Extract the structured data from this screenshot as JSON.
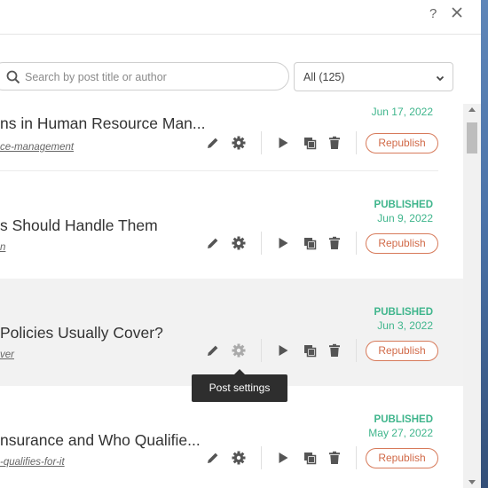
{
  "header": {
    "help_icon": "question-icon",
    "help_label": "?",
    "close_icon": "close-icon"
  },
  "search": {
    "placeholder": "Search by post title or author",
    "icon": "search-icon"
  },
  "filter": {
    "value": "All (125)"
  },
  "actions": {
    "edit_icon": "pencil-icon",
    "settings_icon": "gear-icon",
    "preview_icon": "play-icon",
    "duplicate_icon": "copy-icon",
    "delete_icon": "trash-icon",
    "republish_label": "Republish"
  },
  "posts": [
    {
      "title": "ns in Human Resource Man...",
      "slug": "ce-management",
      "status": "",
      "date": "Jun 17, 2022"
    },
    {
      "title": "s Should Handle Them",
      "slug": "n",
      "status": "PUBLISHED",
      "date": "Jun 9, 2022"
    },
    {
      "title": "Policies Usually Cover?",
      "slug": "ver",
      "status": "PUBLISHED",
      "date": "Jun 3, 2022"
    },
    {
      "title": "nsurance and Who Qualifie...",
      "slug": "-qualifies-for-it",
      "status": "PUBLISHED",
      "date": "May 27, 2022"
    }
  ],
  "tooltip": {
    "text": "Post settings"
  },
  "colors": {
    "published": "#3fb58c",
    "republish": "#d16a48",
    "icon": "#555555"
  }
}
